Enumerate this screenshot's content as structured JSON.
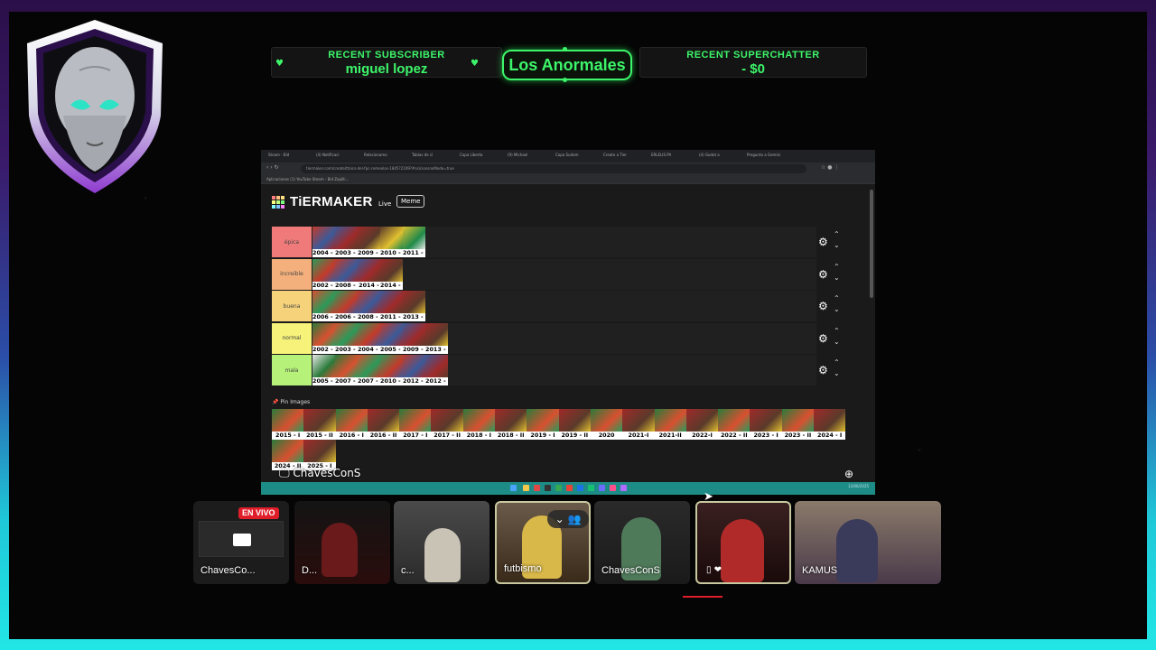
{
  "alerts": {
    "recent_subscriber_label": "RECENT SUBSCRIBER",
    "recent_subscriber_name": "miguel lopez",
    "brand": "Los Anormales",
    "recent_superchatter_label": "RECENT SUPERCHATTER",
    "recent_superchatter_value": "- $0"
  },
  "colors": {
    "accent_green": "#3df56a",
    "live_red": "#e01e2a",
    "frame_cyan": "#22e6e6",
    "frame_purple": "#3a1a6a"
  },
  "browser": {
    "tabs": [
      "Steam - Bid",
      "(4) Notificaci",
      "Relacionamo",
      "Tablas de cl",
      "Copa Liberta",
      "(9) Michael",
      "Copa Sudam",
      "Create a Tier",
      "ERLELIS PA",
      "(4) Godot a",
      "Pregunta a Gemini"
    ],
    "url": "tiermaker.com/create/ttoics-del-fpc-cemeolos-1845?2109?#ocicionsnoMode=true",
    "bookmarks": "Aplicaciones   (1) YouTube   Steam - Bid Zapilli..."
  },
  "tiermaker": {
    "brand": "TiERMAKER",
    "live": "Live",
    "meme": "Meme",
    "pin_images": "Pin Images"
  },
  "tiers": [
    {
      "label": "épica",
      "color": "#f07a7a",
      "items": [
        "2004 - II",
        "2003 - II",
        "2009 - I",
        "2010 - II",
        "2011 - II"
      ]
    },
    {
      "label": "increible",
      "color": "#f4b07c",
      "items": [
        "2002 - I",
        "2008 - I",
        "2014 - ",
        "2014 - II"
      ]
    },
    {
      "label": "buena",
      "color": "#f6d27a",
      "items": [
        "2006 - I",
        "2006 - II",
        "2008 - II",
        "2011 - I",
        "2013 - I"
      ]
    },
    {
      "label": "normal",
      "color": "#f6f27a",
      "items": [
        "2002 - II",
        "2003 - I",
        "2004 - I",
        "2005 - II",
        "2009 - II",
        "2013 - II"
      ]
    },
    {
      "label": "mala",
      "color": "#b6f27a",
      "items": [
        "2005 - I",
        "2007 - I",
        "2007 - II",
        "2010 - I",
        "2012 - I",
        "2012 - II"
      ]
    }
  ],
  "pool": [
    "2015 - I",
    "2015 - II",
    "2016 - I",
    "2016 - II",
    "2017 - I",
    "2017 - II",
    "2018 - I",
    "2018 - II",
    "2019 - I",
    "2019 - II",
    "2020",
    "2021-I",
    "2021-II",
    "2022-I",
    "2022 - II",
    "2023 - I",
    "2023 - II",
    "2024 - I",
    "2024 - II",
    "2025 - I"
  ],
  "share": {
    "sharer_name": "ChavesConS",
    "clock": "13/06/2025"
  },
  "participants": [
    {
      "name": "ChavesCo...",
      "badge": "EN VIVO"
    },
    {
      "name": "D..."
    },
    {
      "name": "c..."
    },
    {
      "name": "futbismo"
    },
    {
      "name": "ChavesConS"
    },
    {
      "name": ""
    },
    {
      "name": "KAMUS"
    }
  ]
}
